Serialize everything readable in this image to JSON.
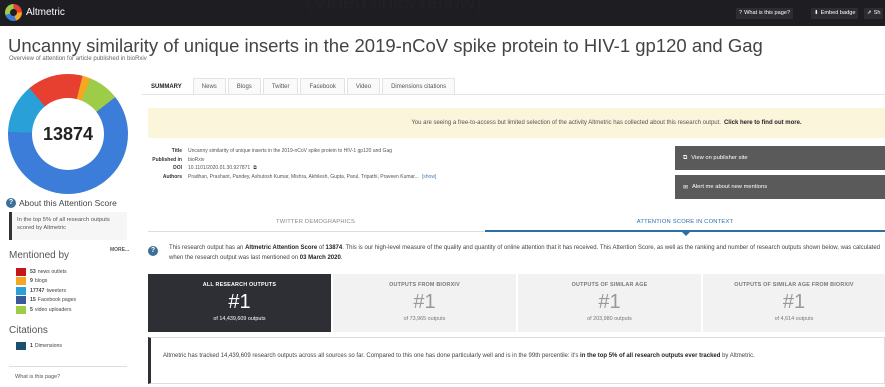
{
  "app": {
    "logo_text": "Altmetric",
    "headline_fragment": "(Video links below)",
    "topbar_buttons": [
      {
        "icon": "help-icon",
        "glyph": "?",
        "label": "What is this page?"
      },
      {
        "icon": "download-icon",
        "glyph": "⬇",
        "label": "Embed badge"
      },
      {
        "icon": "share-icon",
        "glyph": "⇗",
        "label": "Sh"
      }
    ]
  },
  "article": {
    "title": "Uncanny similarity of unique inserts in the 2019-nCoV spike protein to HIV-1 gp120 and Gag",
    "subtitle": "Overview of attention for article published in bioRxiv"
  },
  "score": {
    "value": "13874",
    "about_title": "About this Attention Score",
    "about_text": "In the top 5% of all research outputs scored by Altmetric"
  },
  "mentioned_by": {
    "heading": "Mentioned by",
    "more": "MORE...",
    "items": [
      {
        "count": "53",
        "label": "news outlets",
        "color": "#c4161c"
      },
      {
        "count": "9",
        "label": "blogs",
        "color": "#f5a623"
      },
      {
        "count": "17747",
        "label": "tweeters",
        "color": "#2aa0d8"
      },
      {
        "count": "15",
        "label": "Facebook pages",
        "color": "#3b5998"
      },
      {
        "count": "5",
        "label": "video uploaders",
        "color": "#9ccc48"
      }
    ]
  },
  "citations": {
    "heading": "Citations",
    "count": "1",
    "label": "Dimensions",
    "color": "#1c4e6e"
  },
  "sidebar_footer": "What is this page?",
  "tabs": [
    "SUMMARY",
    "News",
    "Blogs",
    "Twitter",
    "Facebook",
    "Video",
    "Dimensions citations"
  ],
  "notice": {
    "text": "You are seeing a free-to-access but limited selection of the activity Altmetric has collected about this research output.",
    "link": "Click here to find out more."
  },
  "details": {
    "title_label": "Title",
    "title_value": "Uncanny similarity of unique inserts in the 2019-nCoV spike protein to HIV-1 gp120 and Gag",
    "published_label": "Published in",
    "published_value": "bioRxiv",
    "doi_label": "DOI",
    "doi_value": "10.1101/2020.01.30.927871",
    "authors_label": "Authors",
    "authors_value": "Pradhan, Prashant, Pandey, Ashutosh Kumar, Mishra, Akhilesh, Gupta, Parul, Tripathi, Praveen Kumar...",
    "authors_more": "[show]"
  },
  "actions": {
    "publisher": "View on publisher site",
    "alert": "Alert me about new mentions"
  },
  "section_tabs": {
    "left": "TWITTER DEMOGRAPHICS",
    "right": "ATTENTION SCORE IN CONTEXT"
  },
  "context": {
    "p1": "This research output has an",
    "p1_bold": "Altmetric Attention Score",
    "p2": "of",
    "score_bold": "13874",
    "p3": ". This is our high-level measure of the quality and quantity of online attention that it has received. This Attention Score, as well as the ranking and number of research outputs shown below, was calculated when the research output was last mentioned on",
    "date_bold": "03 March 2020",
    "p4": "."
  },
  "stats": [
    {
      "title": "ALL RESEARCH OUTPUTS",
      "rank": "#1",
      "outputs": "of 14,439,609 outputs"
    },
    {
      "title": "OUTPUTS FROM BIORXIV",
      "rank": "#1",
      "outputs": "of 73,965 outputs"
    },
    {
      "title": "OUTPUTS OF SIMILAR AGE",
      "rank": "#1",
      "outputs": "of 203,980 outputs"
    },
    {
      "title": "OUTPUTS OF SIMILAR AGE FROM BIORXIV",
      "rank": "#1",
      "outputs": "of 4,614 outputs"
    }
  ],
  "bottom": {
    "text": "Altmetric has tracked 14,439,609 research outputs across all sources so far. Compared to this one has done particularly well and is in the 99th percentile: it's",
    "bold": "in the top 5% of all research outputs ever tracked",
    "tail": "by Altmetric."
  }
}
